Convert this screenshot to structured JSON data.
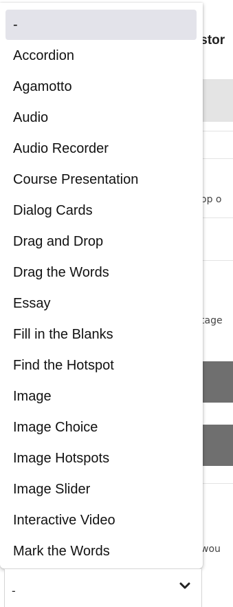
{
  "background": {
    "heading_fragment": "istor",
    "snippet_1": "op o",
    "snippet_2": "tage",
    "snippet_3": "wou"
  },
  "dropdown": {
    "options": [
      "-",
      "Accordion",
      "Agamotto",
      "Audio",
      "Audio Recorder",
      "Course Presentation",
      "Dialog Cards",
      "Drag and Drop",
      "Drag the Words",
      "Essay",
      "Fill in the Blanks",
      "Find the Hotspot",
      "Image",
      "Image Choice",
      "Image Hotspots",
      "Image Slider",
      "Interactive Video",
      "Mark the Words"
    ],
    "selected_index": 0
  },
  "select": {
    "value": "-",
    "icon": "chevron-down-icon"
  }
}
